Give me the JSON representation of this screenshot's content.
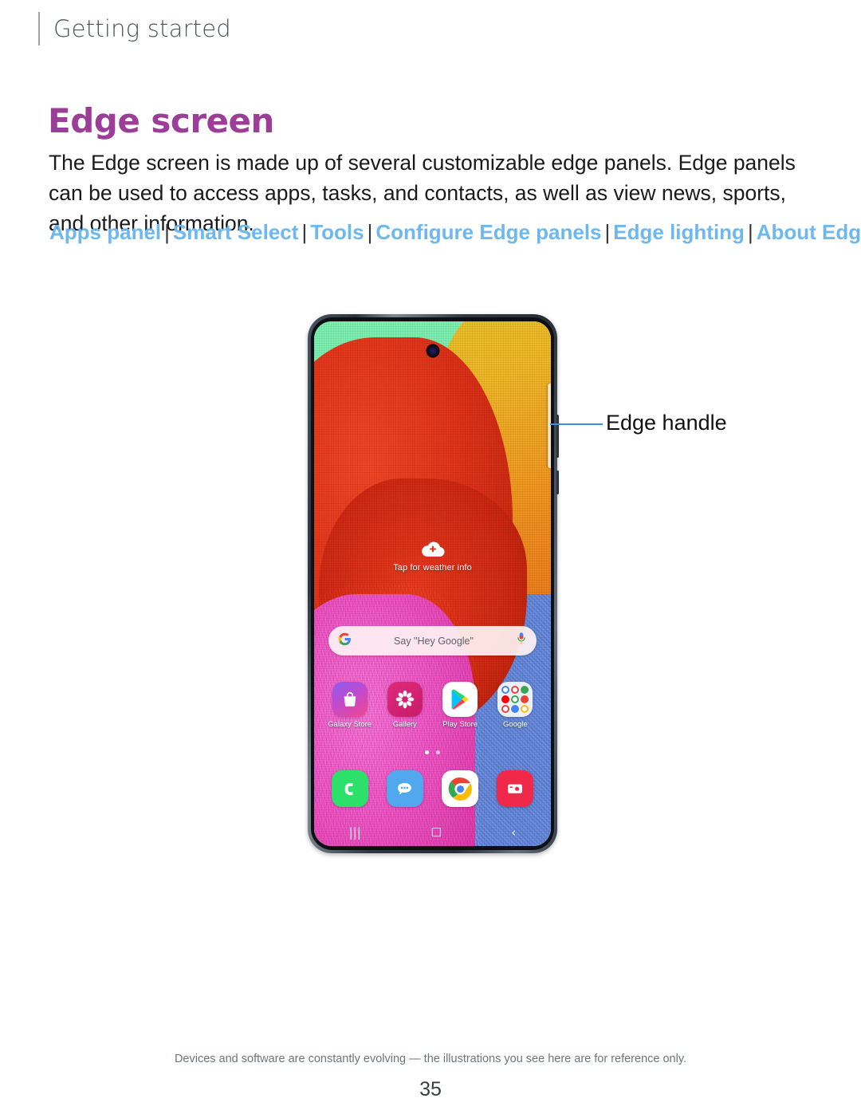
{
  "header": {
    "breadcrumb": "Getting started"
  },
  "page_title": "Edge screen",
  "intro": "The Edge screen is made up of several customizable edge panels. Edge panels can be used to access apps, tasks, and contacts, as well as view news, sports, and other information.",
  "links": {
    "separator": "|",
    "items": [
      {
        "label": "Apps panel"
      },
      {
        "label": "Smart Select"
      },
      {
        "label": "Tools"
      },
      {
        "label": "Configure Edge panels"
      },
      {
        "label": "Edge lighting"
      },
      {
        "label": "About Edge screen"
      }
    ]
  },
  "callout": {
    "label": "Edge handle",
    "line_color": "#3b8fe0"
  },
  "phone": {
    "weather": {
      "icon": "cloud-plus-icon",
      "label": "Tap for weather info"
    },
    "search": {
      "icon": "google-g-icon",
      "placeholder": "Say \"Hey Google\"",
      "mic_icon": "microphone-icon"
    },
    "apps": [
      {
        "name": "galaxy-store",
        "label": "Galaxy Store",
        "icon": "shopping-bag-icon"
      },
      {
        "name": "gallery",
        "label": "Gallery",
        "icon": "flower-icon"
      },
      {
        "name": "play-store",
        "label": "Play Store",
        "icon": "play-triangle-icon"
      },
      {
        "name": "google-folder",
        "label": "Google",
        "icon": "app-folder-icon"
      }
    ],
    "dock": [
      {
        "name": "phone",
        "label": "Phone",
        "icon": "phone-handset-icon"
      },
      {
        "name": "messages",
        "label": "Messages",
        "icon": "chat-bubble-icon"
      },
      {
        "name": "chrome",
        "label": "Chrome",
        "icon": "chrome-icon"
      },
      {
        "name": "camera",
        "label": "Camera",
        "icon": "camera-icon"
      }
    ],
    "navbar": {
      "recents": "|||",
      "home": "☐",
      "back": "‹"
    },
    "page_dots": {
      "count": 2,
      "active_index": 0
    },
    "edge_handle": "edge-handle"
  },
  "footer": {
    "note": "Devices and software are constantly evolving — the illustrations you see here are for reference only.",
    "page_number": "35"
  },
  "colors": {
    "title": "#9c3d97",
    "link": "#6cb8ef",
    "callout": "#3b8fe0",
    "breadcrumb": "#4b5356"
  }
}
